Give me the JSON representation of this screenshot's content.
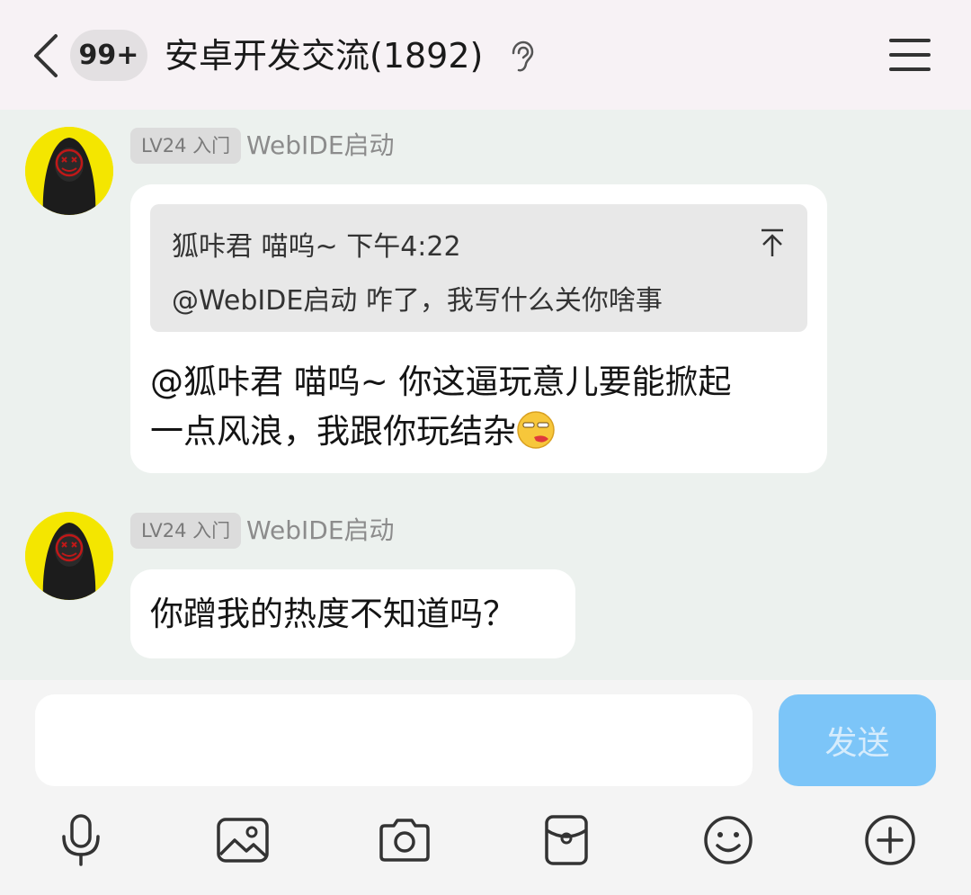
{
  "header": {
    "unread_badge": "99+",
    "title": "安卓开发交流(1892)"
  },
  "messages": [
    {
      "level": "LV24 入门",
      "sender": "WebIDE启动",
      "quote": {
        "header": "狐咔君 喵呜~ 下午4:22",
        "text": "@WebIDE启动 咋了，我写什么关你啥事"
      },
      "text_line1": "@狐咔君 喵呜~ 你这逼玩意儿要能掀起",
      "text_line2": "一点风浪，我跟你玩结杂"
    },
    {
      "level": "LV24 入门",
      "sender": "WebIDE启动",
      "text": "你蹭我的热度不知道吗？"
    }
  ],
  "input": {
    "value": "",
    "send_label": "发送"
  },
  "toolbar": [
    "mic-icon",
    "image-icon",
    "camera-icon",
    "red-packet-icon",
    "emoji-icon",
    "plus-icon"
  ],
  "colors": {
    "header_bg": "#f7f2f5",
    "chat_bg": "#ecf1ee",
    "avatar_bg": "#f4e600",
    "send_button": "#7cc5f8"
  }
}
